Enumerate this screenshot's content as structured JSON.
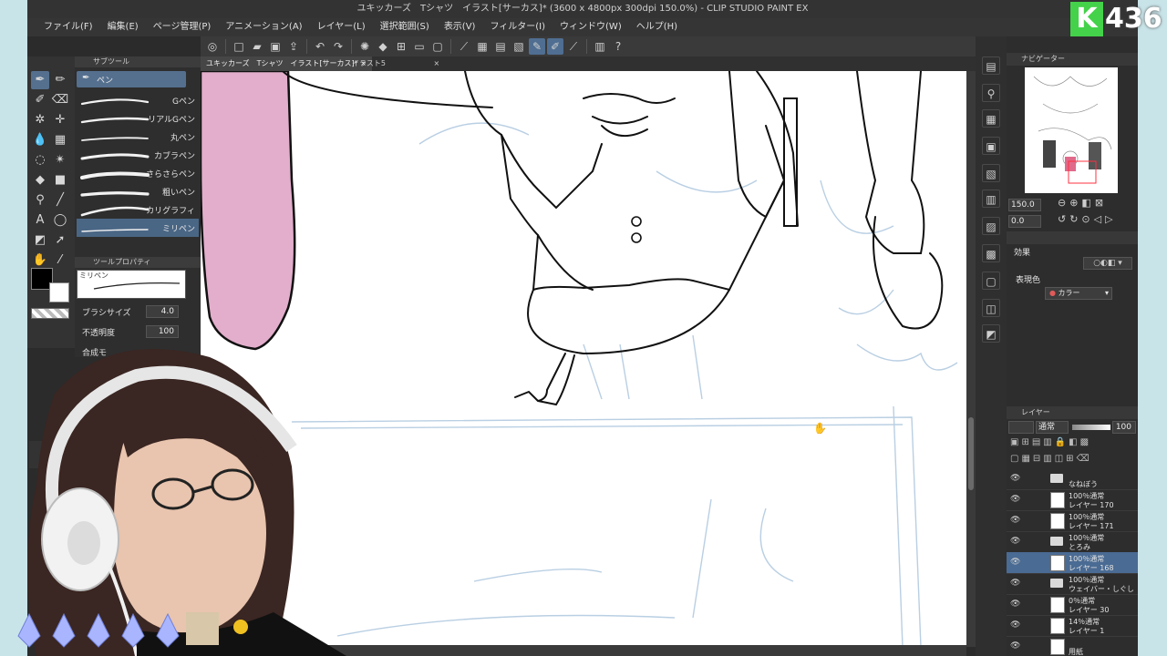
{
  "window": {
    "title": "ユキッカーズ　Tシャツ　イラスト[サーカス]* (3600 x 4800px 300dpi 150.0%)  - CLIP STUDIO PAINT EX"
  },
  "menu": [
    "ファイル(F)",
    "編集(E)",
    "ページ管理(P)",
    "アニメーション(A)",
    "レイヤー(L)",
    "選択範囲(S)",
    "表示(V)",
    "フィルター(I)",
    "ウィンドウ(W)",
    "ヘルプ(H)"
  ],
  "tabs": [
    {
      "label": "ユキッカーズ　Tシャツ　イラスト[サーカス]*",
      "active": true
    },
    {
      "label": "イラスト5",
      "active": false
    }
  ],
  "subtool": {
    "header": "サブツール",
    "group_label": "ペン",
    "brushes": [
      "Gペン",
      "リアルGペン",
      "丸ペン",
      "カブラペン",
      "さらさらペン",
      "粗いペン",
      "カリグラフィ",
      "ミリペン"
    ],
    "selected_index": 7
  },
  "tool_property": {
    "header": "ツールプロパティ",
    "brush_name": "ミリペン",
    "brush_size_label": "ブラシサイズ",
    "brush_size_value": "4.0",
    "opacity_label": "不透明度",
    "opacity_value": "100",
    "blend_label": "合成モ"
  },
  "size_indicator": {
    "value": "4.0",
    "unit": "px"
  },
  "navigator": {
    "header": "ナビゲーター",
    "zoom": "150.0",
    "angle": "0.0"
  },
  "effects": {
    "header": "効果",
    "expression_label": "表現色",
    "color_mode": "カラー"
  },
  "layers": {
    "header": "レイヤー",
    "blend_mode": "通常",
    "opacity": "100",
    "items": [
      {
        "line1": "",
        "line2": "なねぼう",
        "type": "folder",
        "selected": false
      },
      {
        "line1": "100％通常",
        "line2": "レイヤー 170",
        "type": "layer",
        "selected": false
      },
      {
        "line1": "100％通常",
        "line2": "レイヤー 171",
        "type": "layer",
        "selected": false
      },
      {
        "line1": "100％通常",
        "line2": "とろみ",
        "type": "folder",
        "selected": false
      },
      {
        "line1": "100％通常",
        "line2": "レイヤー 168",
        "type": "layer",
        "selected": true
      },
      {
        "line1": "100％通常",
        "line2": "ウェイバー・しぐし",
        "type": "folder",
        "selected": false
      },
      {
        "line1": "0％通常",
        "line2": "レイヤー 30",
        "type": "layer",
        "selected": false
      },
      {
        "line1": "14％通常",
        "line2": "レイヤー 1",
        "type": "layer",
        "selected": false
      },
      {
        "line1": "",
        "line2": "用紙",
        "type": "paper",
        "selected": false
      }
    ]
  },
  "stream_overlay": {
    "logo_letter": "K",
    "logo_number": "436"
  },
  "colors": {
    "accent": "#4a6b93",
    "panel_bg": "#2d2d2d",
    "pink_fill": "#e2aecb"
  }
}
